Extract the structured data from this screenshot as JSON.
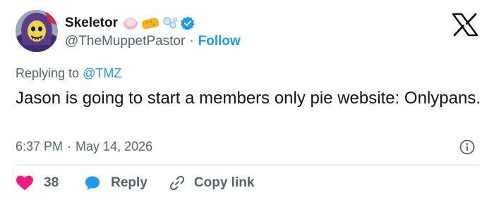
{
  "author": {
    "display_name": "Skeletor",
    "handle": "@TheMuppetPastor",
    "separator": "·",
    "follow_label": "Follow",
    "verified_color": "#1d9bf0"
  },
  "reply_context": {
    "prefix": "Replying to",
    "mention": "@TMZ"
  },
  "tweet": {
    "text": "Jason is going to start a members only pie website: Onlypans.",
    "time": "6:37 PM",
    "separator": "·",
    "date": "May 14, 2026"
  },
  "actions": {
    "like_count": "38",
    "reply_label": "Reply",
    "copy_label": "Copy link"
  },
  "icons": {
    "logo": "x-logo-icon",
    "info": "info-icon",
    "like": "heart-icon",
    "reply": "speech-bubble-icon",
    "copy": "link-icon",
    "verified": "verified-badge-icon",
    "emoji": [
      "soap-dish-emoji",
      "sponge-emoji",
      "bubbles-emoji"
    ]
  },
  "colors": {
    "text": "#0f1419",
    "muted": "#536471",
    "accent": "#1d9bf0",
    "like": "#f91880",
    "divider": "#cfd9de"
  }
}
